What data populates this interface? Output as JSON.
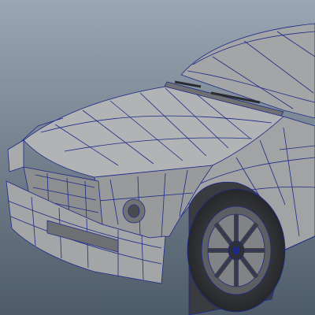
{
  "scene": {
    "subject_icon": "car-wireframe-icon",
    "colors": {
      "bg_top": "#9aa6b2",
      "bg_bottom": "#4e5b68",
      "shade_light": "#b7b8b9",
      "shade_mid": "#a6a7a8",
      "shade_dark": "#7d7e80",
      "shade_deep": "#3e3f43",
      "wire": "#1d2a8a"
    }
  }
}
